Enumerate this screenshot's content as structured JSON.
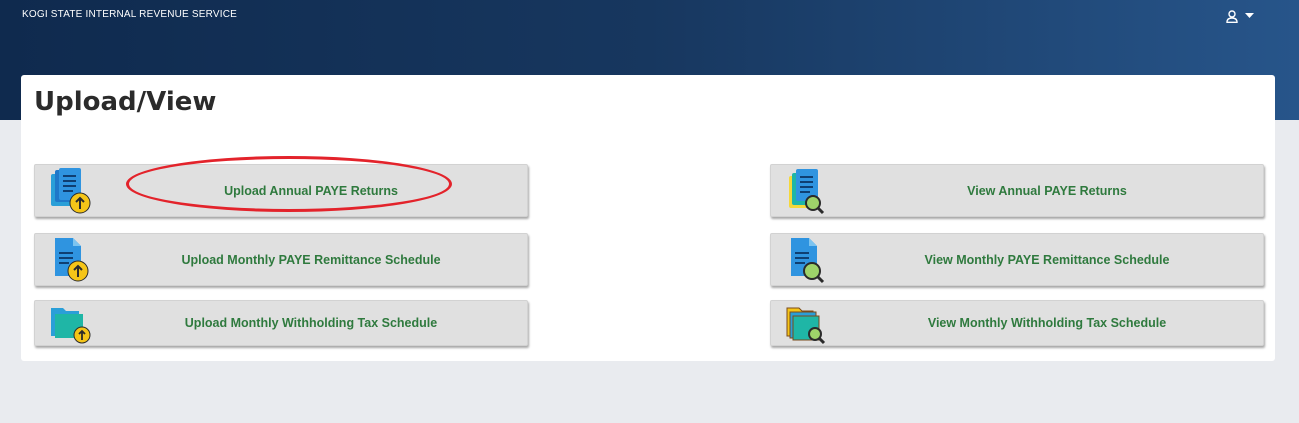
{
  "header": {
    "brand": "KOGI STATE INTERNAL REVENUE SERVICE",
    "user_icon": "user-icon",
    "caret_icon": "caret-down-icon"
  },
  "page": {
    "title": "Upload/View"
  },
  "tiles": [
    {
      "label": "Upload Annual PAYE Returns",
      "icon": "upload-documents-icon"
    },
    {
      "label": "View Annual PAYE Returns",
      "icon": "view-documents-icon"
    },
    {
      "label": "Upload Monthly PAYE Remittance Schedule",
      "icon": "upload-document-icon"
    },
    {
      "label": "View Monthly PAYE Remittance Schedule",
      "icon": "view-document-icon"
    },
    {
      "label": "Upload Monthly Withholding Tax Schedule",
      "icon": "upload-folder-icon"
    },
    {
      "label": "View Monthly Withholding Tax Schedule",
      "icon": "view-folder-icon"
    }
  ],
  "colors": {
    "header_start": "#0f2a4e",
    "header_end": "#27558a",
    "tile_text": "#2f7a3e",
    "highlight": "#e3232b"
  }
}
